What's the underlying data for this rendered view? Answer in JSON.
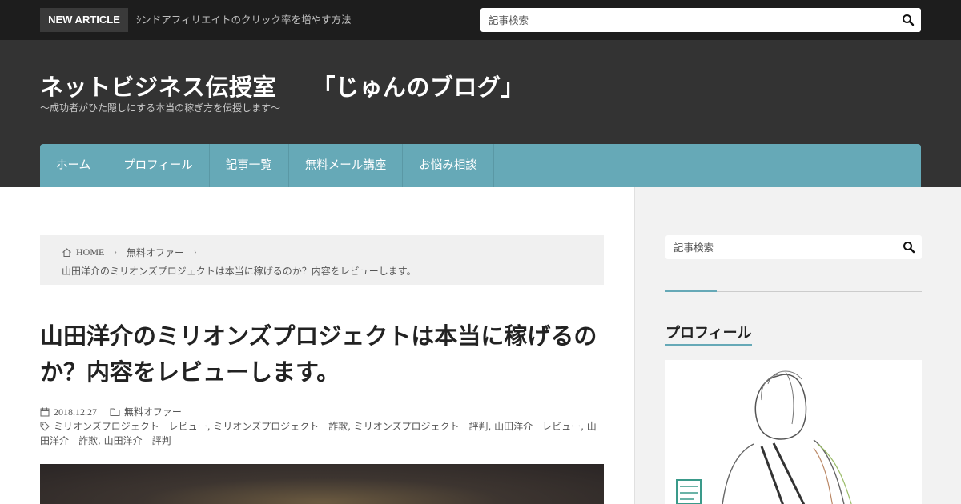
{
  "topbar": {
    "badge": "NEW ARTICLE",
    "ticker": "ｼンドアフィリエイトのクリック率を増やす方法",
    "search_placeholder": "記事検索"
  },
  "header": {
    "title": "ネットビジネス伝授室　　「じゅんのブログ」",
    "tagline": "～成功者がひた隠しにする本当の稼ぎ方を伝授します～"
  },
  "nav": {
    "items": [
      "ホーム",
      "プロフィール",
      "記事一覧",
      "無料メール講座",
      "お悩み相談"
    ]
  },
  "breadcrumb": {
    "home": "HOME",
    "category": "無料オファー",
    "current": "山田洋介のミリオンズプロジェクトは本当に稼げるのか？内容をレビューします。"
  },
  "post": {
    "title": "山田洋介のミリオンズプロジェクトは本当に稼げるのか？内容をレビューします。",
    "date": "2018.12.27",
    "category": "無料オファー",
    "tags": "ミリオンズプロジェクト　レビュー, ミリオンズプロジェクト　詐欺, ミリオンズプロジェクト　評判, 山田洋介　レビュー, 山田洋介　詐欺, 山田洋介　評判"
  },
  "sidebar": {
    "search_placeholder": "記事検索",
    "profile_heading": "プロフィール"
  },
  "colors": {
    "accent": "#66a9b7",
    "header_bg": "#333333",
    "topbar_bg": "#1d1d1d"
  },
  "icons": [
    "search-icon",
    "home-icon",
    "chevron-right-icon",
    "calendar-icon",
    "folder-icon",
    "tag-icon"
  ]
}
